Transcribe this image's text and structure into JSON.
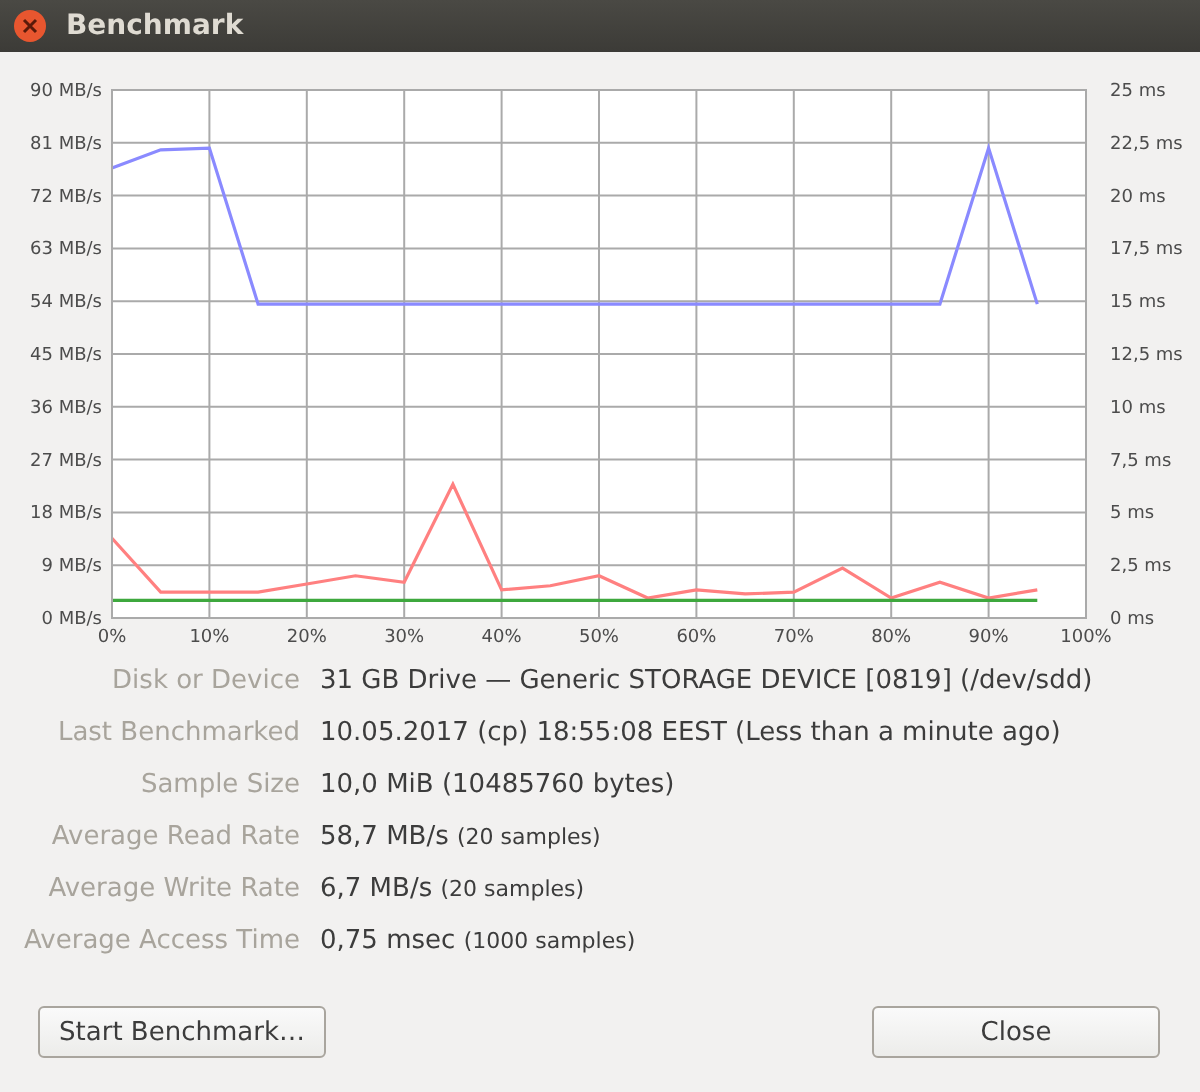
{
  "window": {
    "title": "Benchmark"
  },
  "chart": {
    "chart_data": {
      "type": "line",
      "x": [
        0,
        5,
        10,
        15,
        20,
        25,
        30,
        35,
        40,
        45,
        50,
        55,
        60,
        65,
        70,
        75,
        80,
        85,
        90,
        95
      ],
      "series": [
        {
          "color": "#8a8aff",
          "values": [
            76.7,
            79.8,
            80.1,
            53.5,
            53.5,
            53.5,
            53.5,
            53.5,
            53.5,
            53.5,
            53.5,
            53.5,
            53.5,
            53.5,
            53.5,
            53.5,
            53.5,
            53.5,
            80.1,
            53.5
          ]
        },
        {
          "color": "#ff8080",
          "values": [
            13.6,
            4.4,
            4.4,
            4.4,
            5.8,
            7.2,
            6.1,
            22.8,
            4.8,
            5.5,
            7.2,
            3.4,
            4.8,
            4.1,
            4.4,
            8.5,
            3.4,
            6.1,
            3.4,
            4.8
          ]
        },
        {
          "color": "#3ea83e",
          "values": [
            3,
            3,
            3,
            3,
            3,
            3,
            3,
            3,
            3,
            3,
            3,
            3,
            3,
            3,
            3,
            3,
            3,
            3,
            3,
            3
          ]
        }
      ],
      "grid": true,
      "xlim": [
        0,
        100
      ],
      "ylim": [
        0,
        90
      ],
      "xticks": [
        {
          "value": 0,
          "label": "0%"
        },
        {
          "value": 10,
          "label": "10%"
        },
        {
          "value": 20,
          "label": "20%"
        },
        {
          "value": 30,
          "label": "30%"
        },
        {
          "value": 40,
          "label": "40%"
        },
        {
          "value": 50,
          "label": "50%"
        },
        {
          "value": 60,
          "label": "60%"
        },
        {
          "value": 70,
          "label": "70%"
        },
        {
          "value": 80,
          "label": "80%"
        },
        {
          "value": 90,
          "label": "90%"
        },
        {
          "value": 100,
          "label": "100%"
        }
      ],
      "yticks": [
        {
          "value": 0,
          "label": "0 MB/s"
        },
        {
          "value": 9,
          "label": "9 MB/s"
        },
        {
          "value": 18,
          "label": "18 MB/s"
        },
        {
          "value": 27,
          "label": "27 MB/s"
        },
        {
          "value": 36,
          "label": "36 MB/s"
        },
        {
          "value": 45,
          "label": "45 MB/s"
        },
        {
          "value": 54,
          "label": "54 MB/s"
        },
        {
          "value": 63,
          "label": "63 MB/s"
        },
        {
          "value": 72,
          "label": "72 MB/s"
        },
        {
          "value": 81,
          "label": "81 MB/s"
        },
        {
          "value": 90,
          "label": "90 MB/s"
        }
      ],
      "y2ticks": [
        "0 ms",
        "2,5 ms",
        "5 ms",
        "7,5 ms",
        "10 ms",
        "12,5 ms",
        "15 ms",
        "17,5 ms",
        "20 ms",
        "22,5 ms",
        "25 ms"
      ]
    }
  },
  "details": [
    {
      "label": "Disk or Device",
      "value": "31 GB Drive — Generic STORAGE DEVICE [0819] (/dev/sdd)"
    },
    {
      "label": "Last Benchmarked",
      "value": "10.05.2017 (cp) 18:55:08 EEST (Less than a minute ago)"
    },
    {
      "label": "Sample Size",
      "value": "10,0 MiB (10485760 bytes)"
    },
    {
      "label": "Average Read Rate",
      "value": "58,7 MB/s",
      "note": "(20 samples)"
    },
    {
      "label": "Average Write Rate",
      "value": "6,7 MB/s",
      "note": "(20 samples)"
    },
    {
      "label": "Average Access Time",
      "value": "0,75 msec",
      "note": "(1000 samples)"
    }
  ],
  "buttons": [
    {
      "label": "Start Benchmark…"
    },
    {
      "label": "Close"
    }
  ]
}
